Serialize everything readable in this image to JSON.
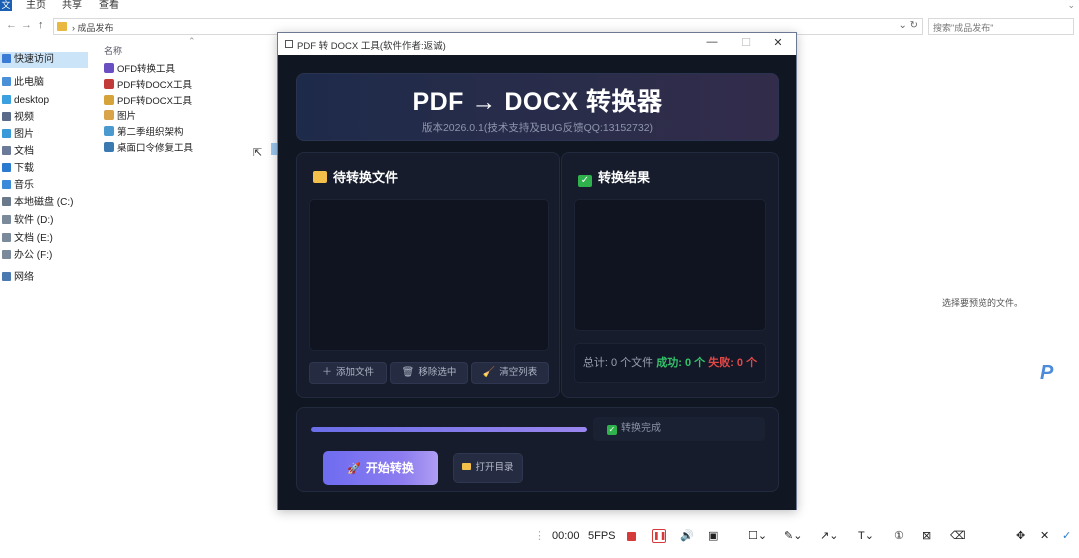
{
  "explorer": {
    "ribbon_tabs": [
      "文件",
      "主页",
      "共享",
      "查看"
    ],
    "address_crumb": "成品发布",
    "search_placeholder": "搜索\"成品发布\"",
    "nav_items": [
      {
        "label": "快速访问",
        "color": "#3a7bd5",
        "selected": true
      },
      {
        "label": "此电脑",
        "color": "#4a90d9"
      },
      {
        "label": "desktop",
        "color": "#3aa0e0"
      },
      {
        "label": "视频",
        "color": "#5a6b8a"
      },
      {
        "label": "图片",
        "color": "#3a9ad9"
      },
      {
        "label": "文档",
        "color": "#6b7a99"
      },
      {
        "label": "下载",
        "color": "#2a7ad0"
      },
      {
        "label": "音乐",
        "color": "#3a8ad9"
      },
      {
        "label": "本地磁盘 (C:)",
        "color": "#6a7a8a"
      },
      {
        "label": "软件 (D:)",
        "color": "#7a8a9a"
      },
      {
        "label": "文档 (E:)",
        "color": "#7a8a9a"
      },
      {
        "label": "办公 (F:)",
        "color": "#7a8a9a"
      },
      {
        "label": "网络",
        "color": "#4a7ab0"
      }
    ],
    "column_header": "名称",
    "files": [
      {
        "name": "OFD转换工具",
        "color": "#6a4fc2"
      },
      {
        "name": "PDF转DOCX工具",
        "color": "#c23a3a"
      },
      {
        "name": "PDF转DOCX工具",
        "color": "#d6a23a"
      },
      {
        "name": "图片",
        "color": "#d9a34a"
      },
      {
        "name": "第二季组织架构",
        "color": "#4a9ad0"
      },
      {
        "name": "桌面口令修复工具",
        "color": "#3a7ab0"
      }
    ],
    "side_hint": "选择要预览的文件。"
  },
  "window": {
    "title": "PDF 转 DOCX 工具(软件作者:返诚)",
    "controls": {
      "minimize": "—",
      "maximize": "☐",
      "close": "✕"
    }
  },
  "banner": {
    "title": "PDF → DOCX 转换器",
    "subtitle": "版本2026.0.1(技术支持及BUG反馈QQ:13152732)"
  },
  "pending": {
    "header": "待转换文件",
    "buttons": {
      "add": {
        "icon": "＋",
        "label": "添加文件"
      },
      "remove": {
        "icon": "🗑",
        "label": "移除选中"
      },
      "clear": {
        "icon": "🧹",
        "label": "清空列表"
      }
    }
  },
  "results": {
    "header": "转换结果",
    "total_label": "总计: 0 个文件",
    "success_label": "成功: 0 个",
    "fail_label": "失败: 0 个"
  },
  "progress": {
    "percent": 100,
    "status_text": "转换完成"
  },
  "actions": {
    "start": {
      "icon": "🚀",
      "label": "开始转换"
    },
    "open_dir": {
      "label": "打开目录"
    }
  },
  "recorder": {
    "time": "00:00",
    "fps": "5FPS"
  }
}
